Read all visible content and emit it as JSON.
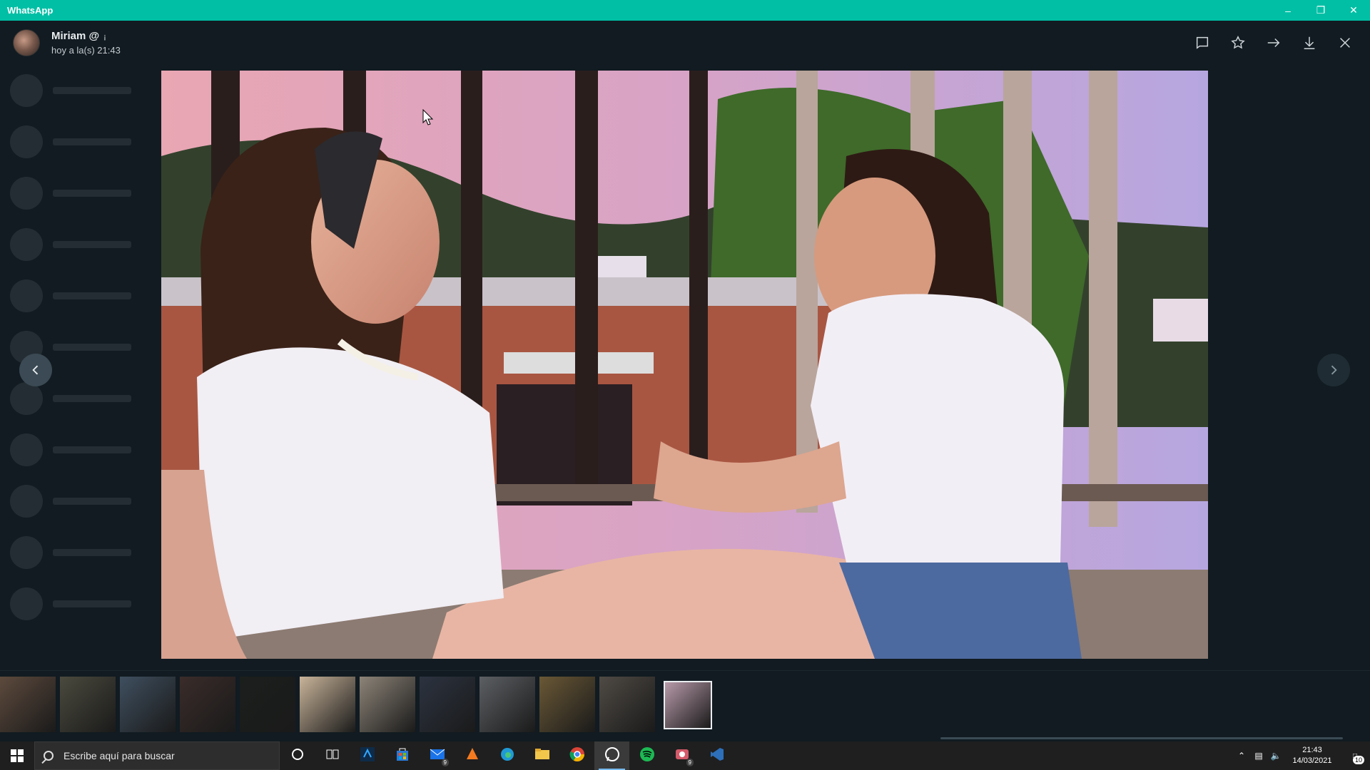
{
  "window": {
    "title": "WhatsApp",
    "controls": [
      "minimize-icon",
      "restore-icon",
      "close-icon"
    ]
  },
  "viewer": {
    "sender_name": "Miriam @",
    "sender_badge": "¡",
    "timestamp": "hoy a la(s) 21:43",
    "actions": [
      "message-icon",
      "star-icon",
      "forward-icon",
      "download-icon",
      "close-icon"
    ]
  },
  "photo": {
    "description_icon": "photo-two-girls-balcony"
  },
  "thumbnails": {
    "count": 12,
    "active_index": 11,
    "palette": [
      "#5d4a3d",
      "#4b4a3e",
      "#3f4f5f",
      "#3a2c2a",
      "#1b1f1c",
      "#c9b49a",
      "#8d8478",
      "#2c3340",
      "#5c5f63",
      "#6a5836",
      "#4f4a44",
      "#b79aa9"
    ]
  },
  "taskbar": {
    "search_placeholder": "Escribe aquí para buscar",
    "apps": [
      {
        "name": "cortana-icon"
      },
      {
        "name": "task-view-icon"
      },
      {
        "name": "photoshop-icon"
      },
      {
        "name": "store-icon"
      },
      {
        "name": "mail-icon",
        "badge": "9"
      },
      {
        "name": "office-icon"
      },
      {
        "name": "edge-icon"
      },
      {
        "name": "file-explorer-icon"
      },
      {
        "name": "chrome-icon"
      },
      {
        "name": "whatsapp-icon",
        "active": true
      },
      {
        "name": "spotify-icon"
      },
      {
        "name": "video-app-icon",
        "badge": "9"
      },
      {
        "name": "visual-studio-icon"
      }
    ],
    "time": "21:43",
    "date": "14/03/2021",
    "notification_count": "10"
  },
  "colors": {
    "accent": "#00bfa5",
    "background": "#111b21",
    "taskbar": "#1f1f1f"
  }
}
